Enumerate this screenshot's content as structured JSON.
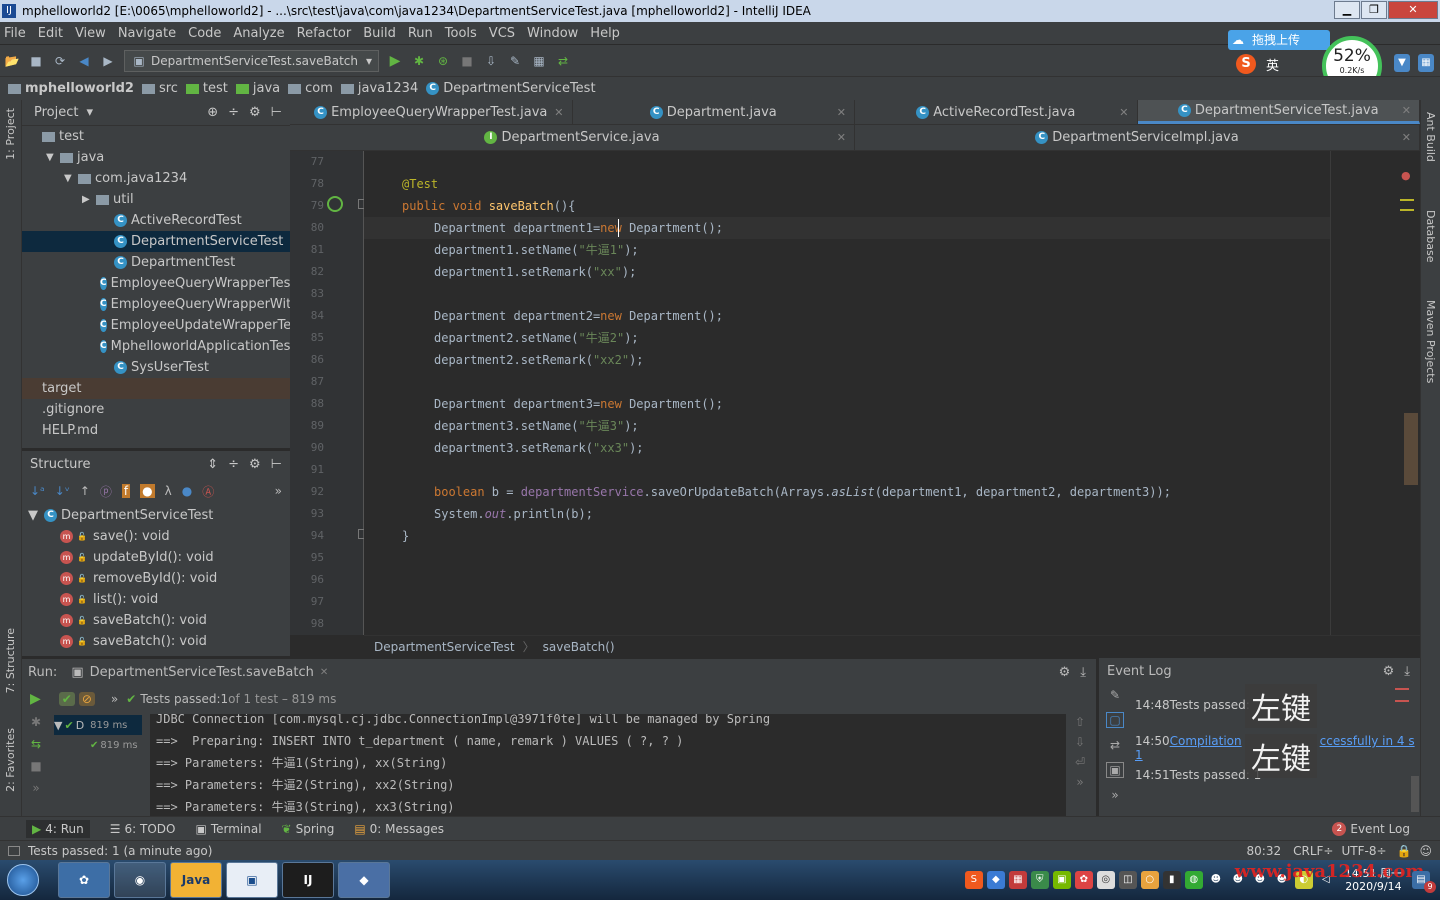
{
  "window": {
    "title": "mphelloworld2 [E:\\0065\\mphelloworld2] - ...\\src\\test\\java\\com\\java1234\\DepartmentServiceTest.java [mphelloworld2] - IntelliJ IDEA",
    "min": "▁",
    "max": "❐",
    "close": "✕"
  },
  "menu": [
    "File",
    "Edit",
    "View",
    "Navigate",
    "Code",
    "Analyze",
    "Refactor",
    "Build",
    "Run",
    "Tools",
    "VCS",
    "Window",
    "Help"
  ],
  "toolbar": {
    "run_config": "DepartmentServiceTest.saveBatch"
  },
  "overlay": {
    "upload": "拖拽上传",
    "percent": "52%",
    "speed": "0.2K/s",
    "ime_lang": "英"
  },
  "breadcrumb": [
    "mphelloworld2",
    "src",
    "test",
    "java",
    "com",
    "java1234",
    "DepartmentServiceTest"
  ],
  "project": {
    "header": "Project",
    "rows": [
      {
        "label": "test",
        "indent": 0,
        "icon": "folder",
        "arrow": ""
      },
      {
        "label": "java",
        "indent": 1,
        "icon": "folder",
        "arrow": "▼"
      },
      {
        "label": "com.java1234",
        "indent": 2,
        "icon": "folder",
        "arrow": "▼"
      },
      {
        "label": "util",
        "indent": 3,
        "icon": "folder",
        "arrow": "▶"
      },
      {
        "label": "ActiveRecordTest",
        "indent": 4,
        "icon": "class",
        "arrow": ""
      },
      {
        "label": "DepartmentServiceTest",
        "indent": 4,
        "icon": "class",
        "arrow": "",
        "selected": true
      },
      {
        "label": "DepartmentTest",
        "indent": 4,
        "icon": "class",
        "arrow": ""
      },
      {
        "label": "EmployeeQueryWrapperTest",
        "indent": 4,
        "icon": "class",
        "arrow": ""
      },
      {
        "label": "EmployeeQueryWrapperWithPag",
        "indent": 4,
        "icon": "class",
        "arrow": ""
      },
      {
        "label": "EmployeeUpdateWrapperTest",
        "indent": 4,
        "icon": "class",
        "arrow": ""
      },
      {
        "label": "MphelloworldApplicationTests",
        "indent": 4,
        "icon": "class",
        "arrow": ""
      },
      {
        "label": "SysUserTest",
        "indent": 4,
        "icon": "class",
        "arrow": ""
      },
      {
        "label": "target",
        "indent": 0,
        "icon": "none",
        "arrow": ""
      },
      {
        "label": ".gitignore",
        "indent": 0,
        "icon": "none",
        "arrow": ""
      },
      {
        "label": "HELP.md",
        "indent": 0,
        "icon": "none",
        "arrow": ""
      }
    ]
  },
  "structure": {
    "header": "Structure",
    "root": "DepartmentServiceTest",
    "methods": [
      "save(): void",
      "updateById(): void",
      "removeById(): void",
      "list(): void",
      "saveBatch(): void",
      "saveBatch(): void"
    ]
  },
  "side_tabs": {
    "project": "1: Project",
    "structure": "7: Structure",
    "favorites": "2: Favorites",
    "ant": "Ant Build",
    "database": "Database",
    "maven": "Maven Projects"
  },
  "tabs_row1": [
    "EmployeeQueryWrapperTest.java",
    "Department.java",
    "ActiveRecordTest.java",
    "DepartmentServiceTest.java"
  ],
  "tabs_row2": [
    "DepartmentService.java",
    "DepartmentServiceImpl.java"
  ],
  "line_numbers": [
    "77",
    "78",
    "79",
    "80",
    "81",
    "82",
    "83",
    "84",
    "85",
    "86",
    "87",
    "88",
    "89",
    "90",
    "91",
    "92",
    "93",
    "94",
    "95",
    "96",
    "97",
    "98"
  ],
  "code": {
    "l78": "@Test",
    "l79_kw": "public void ",
    "l79_fn": "saveBatch",
    "l79_rest": "(){",
    "l80_a": "Department department1=",
    "l80_kw": "new",
    " l80_b": "",
    "l80_b": " Department();",
    "l81_a": "department1.setName(",
    "l81_s": "\"牛逼1\"",
    "l81_b": ");",
    "l82_a": "department1.setRemark(",
    "l82_s": "\"xx\"",
    "l82_b": ");",
    "l84_a": "Department department2=",
    "l84_kw": "new",
    "l84_b": " Department();",
    "l85_a": "department2.setName(",
    "l85_s": "\"牛逼2\"",
    "l85_b": ");",
    "l86_a": "department2.setRemark(",
    "l86_s": "\"xx2\"",
    "l86_b": ");",
    "l88_a": "Department department3=",
    "l88_kw": "new",
    "l88_b": " Department();",
    "l89_a": "department3.setName(",
    "l89_s": "\"牛逼3\"",
    "l89_b": ");",
    "l90_a": "department3.setRemark(",
    "l90_s": "\"xx3\"",
    "l90_b": ");",
    "l92_kw": "boolean",
    "l92_a": " b = ",
    "l92_f": "departmentService",
    "l92_b": ".saveOrUpdateBatch(Arrays.",
    "l92_m": "asList",
    "l92_c": "(department1, department2, department3));",
    "l93_a": "System.",
    "l93_f": "out",
    "l93_b": ".println(b);",
    "l94": "}"
  },
  "editor_breadcrumb": [
    "DepartmentServiceTest",
    "saveBatch()"
  ],
  "run": {
    "label": "Run:",
    "config": "DepartmentServiceTest.saveBatch",
    "status_pass": "Tests passed: ",
    "status_count": "1",
    "status_of": " of 1 test – 819 ms",
    "tree_item": "D",
    "tree_time": "819 ms",
    "tree_time2": "819 ms",
    "console": [
      "JDBC Connection [com.mysql.cj.jdbc.ConnectionImpl@3971f0te] will be managed by Spring",
      "==>  Preparing: INSERT INTO t_department ( name, remark ) VALUES ( ?, ? )",
      "==> Parameters: 牛逼1(String), xx(String)",
      "==> Parameters: 牛逼2(String), xx2(String)",
      "==> Parameters: 牛逼3(String), xx3(String)"
    ]
  },
  "event_log": {
    "title": "Event Log",
    "entries": [
      {
        "time": "14:48",
        "text": "Tests passed:"
      },
      {
        "time": "14:50",
        "text": "Compilation",
        "tail": "ccessfully in 4 s 1"
      },
      {
        "time": "14:51",
        "text": "Tests passed: 1"
      }
    ],
    "overlay1": "左键",
    "overlay2": "左键"
  },
  "bottom_tabs": [
    "4: Run",
    "6: TODO",
    "Terminal",
    "Spring",
    "0: Messages"
  ],
  "event_log_tab": "Event Log",
  "event_log_badge": "2",
  "status": {
    "message": "Tests passed: 1 (a minute ago)",
    "position": "80:32",
    "line_sep": "CRLF÷",
    "encoding": "UTF-8÷"
  },
  "taskbar": {
    "apps": [
      "",
      "",
      "",
      "Java",
      "",
      "IJ",
      ""
    ],
    "time": "14:51",
    "weekday": "周一",
    "date": "2020/9/14",
    "watermark": "www.java1234.com",
    "badge": "9"
  },
  "colors": {
    "accent": "#4a88c7",
    "selection": "#0d293e",
    "keyword": "#cc7832",
    "string": "#6a8759",
    "annotation": "#bbb529",
    "function": "#ffc66d",
    "pass": "#62b543"
  }
}
